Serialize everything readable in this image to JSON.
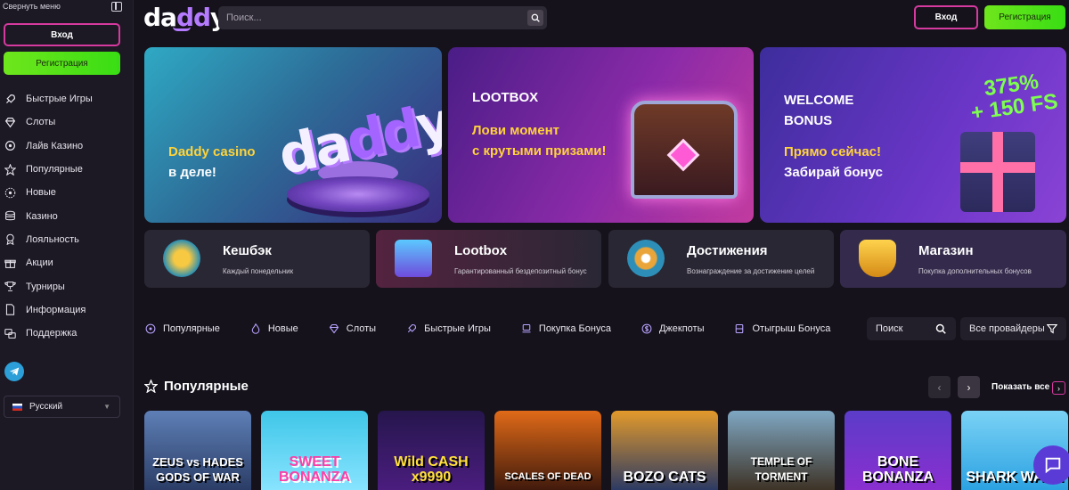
{
  "sidebar": {
    "collapse_label": "Свернуть меню",
    "login_label": "Вход",
    "register_label": "Регистрация",
    "items": [
      {
        "label": "Быстрые Игры",
        "icon": "rocket-icon"
      },
      {
        "label": "Слоты",
        "icon": "diamond-icon"
      },
      {
        "label": "Лайв Казино",
        "icon": "live-icon"
      },
      {
        "label": "Популярные",
        "icon": "star-icon"
      },
      {
        "label": "Новые",
        "icon": "new-icon"
      },
      {
        "label": "Казино",
        "icon": "chips-icon"
      },
      {
        "label": "Лояльность",
        "icon": "medal-icon"
      },
      {
        "label": "Акции",
        "icon": "gift-icon"
      },
      {
        "label": "Турниры",
        "icon": "trophy-icon"
      },
      {
        "label": "Информация",
        "icon": "document-icon"
      },
      {
        "label": "Поддержка",
        "icon": "support-icon"
      }
    ],
    "language": "Русский"
  },
  "header": {
    "logo_prefix": "da",
    "logo_accent": "dd",
    "logo_suffix": "y",
    "search_placeholder": "Поиск...",
    "login_label": "Вход",
    "register_label": "Регистрация"
  },
  "banners": [
    {
      "title": "",
      "line1": "Daddy casino",
      "line2": "в деле!"
    },
    {
      "title": "LOOTBOX",
      "line1": "Лови момент",
      "line2": "с крутыми призами!"
    },
    {
      "title": "WELCOME",
      "title2": "BONUS",
      "line1": "Прямо сейчас!",
      "line2": "Забирай бонус",
      "promo1": "375%",
      "promo2": "+ 150 FS"
    }
  ],
  "cards": [
    {
      "title": "Кешбэк",
      "subtitle": "Каждый понедельник"
    },
    {
      "title": "Lootbox",
      "subtitle": "Гарантированный бездепозитный бонус"
    },
    {
      "title": "Достижения",
      "subtitle": "Вознаграждение за достижение целей"
    },
    {
      "title": "Магазин",
      "subtitle": "Покупка дополнительных бонусов"
    }
  ],
  "tabs": [
    "Популярные",
    "Новые",
    "Слоты",
    "Быстрые Игры",
    "Покупка Бонуса",
    "Джекпоты",
    "Отыгрыш Бонуса"
  ],
  "filter": {
    "search_label": "Поиск",
    "providers_label": "Все провайдеры"
  },
  "popular": {
    "title": "Популярные",
    "show_all": "Показать все",
    "games": [
      "ZEUS vs HADES GODS OF WAR",
      "SWEET BONANZA",
      "Wild CASH x9990",
      "SCALES OF DEAD",
      "BOZO CATS",
      "TEMPLE OF TORMENT",
      "BONE BONANZA",
      "SHARK WASH"
    ]
  },
  "colors": {
    "accent_pink": "#d63a9e",
    "accent_green": "#4fe218",
    "accent_purple": "#b57bff",
    "yellow": "#ffd33a"
  }
}
